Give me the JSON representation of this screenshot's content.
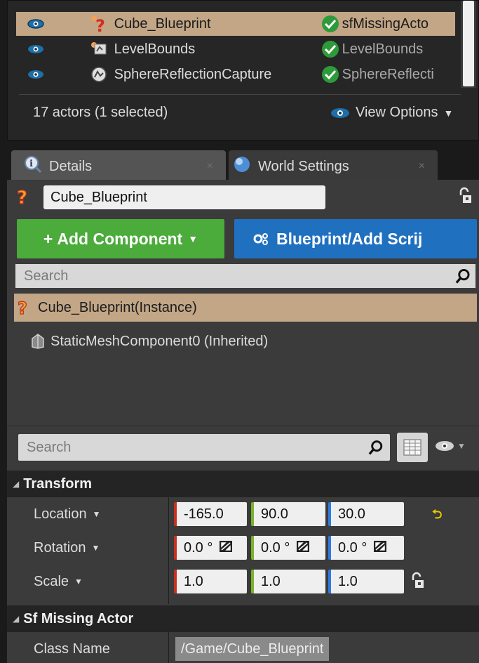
{
  "outliner": {
    "rows": [
      {
        "name": "Cube_Blueprint",
        "class": "sfMissingActo",
        "selected": true
      },
      {
        "name": "LevelBounds",
        "class": "LevelBounds",
        "selected": false
      },
      {
        "name": "SphereReflectionCapture",
        "class": "SphereReflecti",
        "selected": false
      }
    ],
    "count": "17 actors (1 selected)",
    "view_options": "View Options"
  },
  "tabs": [
    {
      "label": "Details",
      "close": "×",
      "active": true
    },
    {
      "label": "World Settings",
      "close": "×",
      "active": false
    }
  ],
  "details": {
    "actor_name": "Cube_Blueprint",
    "add_component": "Add Component",
    "add_component_prefix": "+",
    "blueprint_button": "Blueprint/Add Scrij",
    "component_search_placeholder": "Search",
    "instance_row": "Cube_Blueprint(Instance)",
    "component": "StaticMeshComponent0 (Inherited)",
    "property_search_placeholder": "Search"
  },
  "transform": {
    "header": "Transform",
    "location": {
      "label": "Location",
      "x": "-165.0",
      "y": "90.0",
      "z": "30.0"
    },
    "rotation": {
      "label": "Rotation",
      "x": "0.0 °",
      "y": "0.0 °",
      "z": "0.0 °"
    },
    "scale": {
      "label": "Scale",
      "x": "1.0",
      "y": "1.0",
      "z": "1.0"
    }
  },
  "sf_missing_actor": {
    "header": "Sf Missing Actor",
    "class_name_label": "Class Name",
    "class_name_value": "/Game/Cube_Blueprint"
  },
  "colors": {
    "selection": "#c2a686",
    "add_component": "#4bab3b",
    "blueprint_button": "#2070c0",
    "axis_x": "#c8301e",
    "axis_y": "#7ab22a",
    "axis_z": "#2e7ae0"
  }
}
